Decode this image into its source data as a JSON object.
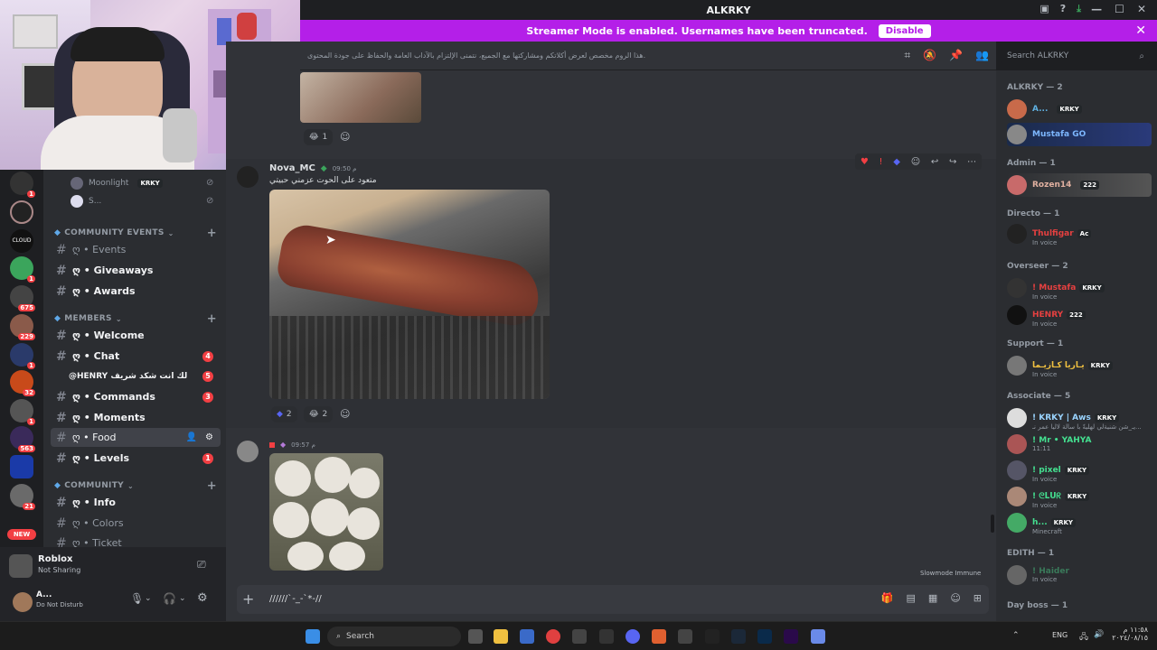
{
  "window": {
    "title": "ALKRKY"
  },
  "banner": {
    "text": "Streamer Mode is enabled. Usernames have been truncated.",
    "disable_label": "Disable"
  },
  "toolbar": {
    "topic": "هذا الروم مخصص لعرض أكلاتكم ومشاركتها مع الجميع، نتمنى الإلتزام بالآداب العامة والحفاظ على جودة المحتوى.",
    "search_placeholder": "Search ALKRKY"
  },
  "servers": {
    "badges": [
      "1",
      "1",
      "675",
      "229",
      "1",
      "32",
      "1",
      "21",
      "563",
      "1",
      "21"
    ],
    "new_label": "NEW"
  },
  "channels": {
    "voice_users": [
      {
        "name": "Moonlight",
        "tag": "KRKY"
      },
      {
        "name": "S..."
      }
    ],
    "categories": [
      {
        "name": "COMMUNITY EVENTS",
        "items": [
          {
            "label": "ღ • Events"
          },
          {
            "label": "ღ • Giveaways"
          },
          {
            "label": "ღ • Awards"
          }
        ]
      },
      {
        "name": "MEMBERS",
        "items": [
          {
            "label": "ღ • Welcome"
          },
          {
            "label": "ღ • Chat",
            "count": "4"
          },
          {
            "label": "@HENRY لك انت شكد شريف",
            "count": "5"
          },
          {
            "label": "ღ • Commands",
            "count": "3"
          },
          {
            "label": "ღ • Moments"
          },
          {
            "label": "ღ • Food"
          },
          {
            "label": "ღ • Levels",
            "count": "1"
          }
        ]
      },
      {
        "name": "COMMUNITY",
        "items": [
          {
            "label": "ღ • Info"
          },
          {
            "label": "ღ • Colors"
          },
          {
            "label": "ღ • Ticket"
          }
        ]
      }
    ]
  },
  "activity": {
    "title": "Roblox",
    "status": "Not Sharing"
  },
  "user": {
    "name": "A...",
    "status": "Do Not Disturb"
  },
  "messages": {
    "prev_reaction": "1",
    "msg1": {
      "author": "Nova_MC",
      "time": "09:50 م",
      "text": "متعود على الحوت عزمني حبيتي",
      "reactions": [
        {
          "emoji": "blue",
          "count": "2"
        },
        {
          "emoji": "grin",
          "count": "2"
        }
      ]
    },
    "msg2": {
      "time": "09:57 م"
    }
  },
  "composer": {
    "value": "//////`-_-`*-//"
  },
  "slowmode": "Slowmode Immune",
  "members": {
    "groups": [
      {
        "title": "ALKRKY — 2",
        "members": [
          {
            "name": "A...",
            "tag": "KRKY",
            "color": "#5fb0e0"
          },
          {
            "name": "Mustafa GO",
            "color": "#7db7ff"
          }
        ]
      },
      {
        "title": "Admin — 1",
        "members": [
          {
            "name": "Rozen14",
            "tag": "222",
            "color": "#e0b0a0"
          }
        ]
      },
      {
        "title": "Directo — 1",
        "members": [
          {
            "name": "Thulfigar",
            "tag": "Ac",
            "sub": "In voice",
            "color": "#e64040"
          }
        ]
      },
      {
        "title": "Overseer — 2",
        "members": [
          {
            "name": "! Mustafa",
            "tag": "KRKY",
            "sub": "In voice",
            "color": "#e64040"
          },
          {
            "name": "HENRY",
            "tag": "222",
            "sub": "In voice",
            "color": "#e64040"
          }
        ]
      },
      {
        "title": "Support — 1",
        "members": [
          {
            "name": "يـاريا كـازيـما",
            "tag": "KRKY",
            "sub": "In voice",
            "color": "#f0c040"
          }
        ]
      },
      {
        "title": "Associate — 5",
        "members": [
          {
            "name": "! KRKY | Aws",
            "tag": "KRKY",
            "sub": "يـ_شن شنيةلي لهليةً با سألة لاليا عمر نـ...",
            "color": "#9ad4ff"
          },
          {
            "name": "! Mr • YAHYA",
            "sub": "11:11",
            "color": "#44e090"
          },
          {
            "name": "! pixel",
            "tag": "KRKY",
            "sub": "In voice",
            "color": "#44e090"
          },
          {
            "name": "! ᘓᒪᑌᖇ",
            "tag": "KRKY",
            "sub": "In voice",
            "color": "#44e090"
          },
          {
            "name": "h...",
            "tag": "KRKY",
            "sub": "Minecraft",
            "color": "#44e090"
          }
        ]
      },
      {
        "title": "EDITH — 1",
        "members": [
          {
            "name": "! Haider",
            "sub": "In voice",
            "color": "#3a7a5a"
          }
        ]
      },
      {
        "title": "Day boss — 1",
        "members": []
      }
    ]
  },
  "taskbar": {
    "search": "Search",
    "lang": "ENG",
    "time": "١١:٥٨ م",
    "date": "٢٠٢٤/٠٨/١٥"
  }
}
